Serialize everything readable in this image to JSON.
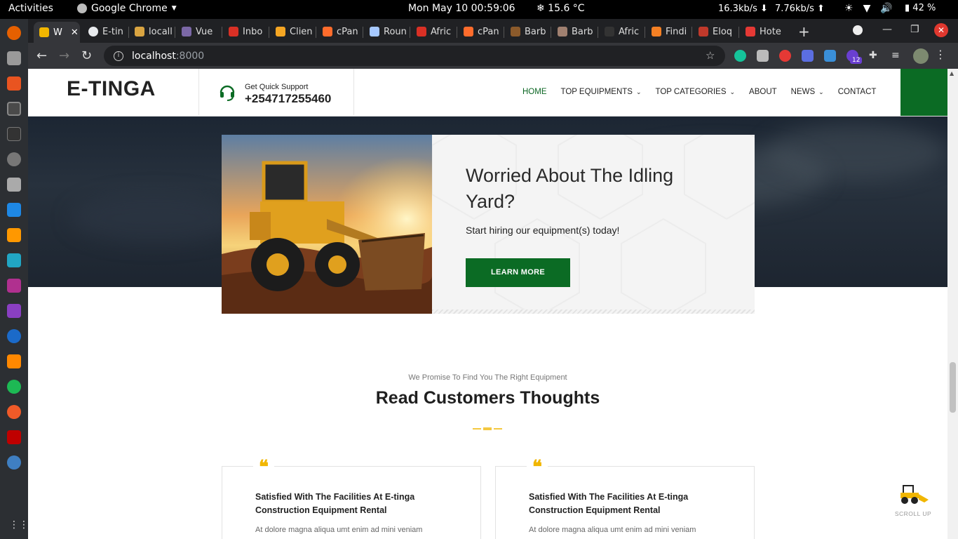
{
  "system": {
    "activities": "Activities",
    "app_name": "Google Chrome",
    "clock": "Mon May 10  00:59:06",
    "weather": "❄ 15.6 °C",
    "net_down": "16.3kb/s ⬇",
    "net_up": "7.76kb/s ⬆",
    "battery": "42 %"
  },
  "browser": {
    "tabs": [
      {
        "label": "W",
        "color": "#f1b600",
        "active": true
      },
      {
        "label": "E-tin",
        "color": "#e8eaed"
      },
      {
        "label": "locall",
        "color": "#d9a441"
      },
      {
        "label": "Vue",
        "color": "#7b68a6"
      },
      {
        "label": "Inbo",
        "color": "#d93025"
      },
      {
        "label": "Clien",
        "color": "#f5a623"
      },
      {
        "label": "cPan",
        "color": "#ff6c2c"
      },
      {
        "label": "Roun",
        "color": "#a6c8ff"
      },
      {
        "label": "Afric",
        "color": "#d93025"
      },
      {
        "label": "cPan",
        "color": "#ff6c2c"
      },
      {
        "label": "Barb",
        "color": "#8b5a2b"
      },
      {
        "label": "Barb",
        "color": "#a08070"
      },
      {
        "label": "Afric",
        "color": "#333333"
      },
      {
        "label": "Findi",
        "color": "#f48024"
      },
      {
        "label": "Eloq",
        "color": "#c0392b"
      },
      {
        "label": "Hote",
        "color": "#e53935"
      }
    ],
    "new_tab": "+",
    "url_host": "localhost",
    "url_port": ":8000",
    "ext_badge": "12"
  },
  "site": {
    "logo": "E-TINGA",
    "support_label": "Get Quick Support",
    "support_phone": "+254717255460",
    "nav": {
      "home": "HOME",
      "top_equipments": "TOP EQUIPMENTS",
      "top_categories": "TOP CATEGORIES",
      "about": "ABOUT",
      "news": "NEWS",
      "contact": "CONTACT"
    },
    "promo": {
      "title": "Worried About The Idling Yard?",
      "subtitle": "Start hiring our equipment(s) today!",
      "button": "LEARN MORE"
    },
    "testimonials_section": {
      "kicker": "We Promise To Find You The Right Equipment",
      "title": "Read Customers Thoughts"
    },
    "testimonials": [
      {
        "title": "Satisfied With The Facilities At E-tinga Construction Equipment Rental",
        "text": "At dolore magna aliqua umt enim ad mini veniam"
      },
      {
        "title": "Satisfied With The Facilities At E-tinga Construction Equipment Rental",
        "text": "At dolore magna aliqua umt enim ad mini veniam"
      }
    ],
    "scroll_up": "SCROLL UP"
  },
  "colors": {
    "brand_green": "#0b6b24",
    "accent_yellow": "#f1b600",
    "nav_active": "#0b6623"
  }
}
